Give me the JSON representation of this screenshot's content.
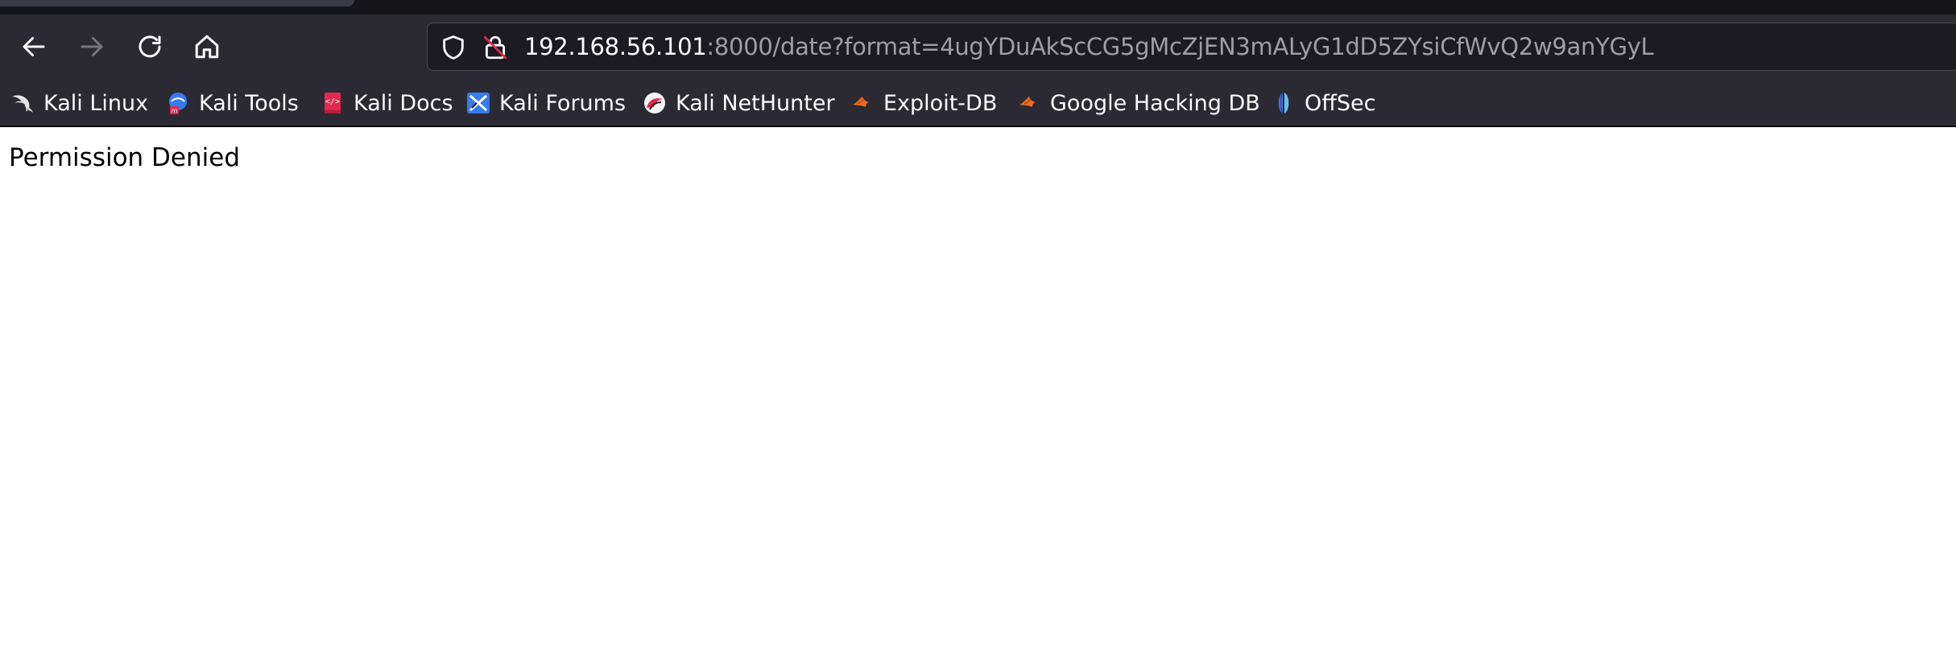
{
  "browser": {
    "colors": {
      "toolbar": "#2b2a33",
      "urlbar": "#1c1b22",
      "text": "#fbfbfe",
      "muted": "#9f9ea6",
      "insecure": "#e22850"
    },
    "nav": {
      "back_icon": "arrow-left-icon",
      "forward_icon": "arrow-right-icon",
      "reload_icon": "reload-icon",
      "home_icon": "home-icon"
    },
    "url": {
      "host": "192.168.56.101",
      "path": ":8000/date?format=4ugYDuAkScCG5gMcZjEN3mALyG1dD5ZYsiCfWvQ2w9anYGyL",
      "tracking_icon": "shield-icon",
      "security_icon": "insecure-lock-icon"
    },
    "bookmarks": [
      {
        "label": "Kali Linux",
        "icon": "kali-dragon-icon"
      },
      {
        "label": "Kali Tools",
        "icon": "kali-tools-icon"
      },
      {
        "label": "Kali Docs",
        "icon": "kali-docs-icon"
      },
      {
        "label": "Kali Forums",
        "icon": "kali-forums-icon"
      },
      {
        "label": "Kali NetHunter",
        "icon": "nethunter-icon"
      },
      {
        "label": "Exploit-DB",
        "icon": "exploit-db-icon"
      },
      {
        "label": "Google Hacking DB",
        "icon": "ghdb-icon"
      },
      {
        "label": "OffSec",
        "icon": "offsec-icon"
      }
    ]
  },
  "page": {
    "message": "Permission Denied"
  }
}
